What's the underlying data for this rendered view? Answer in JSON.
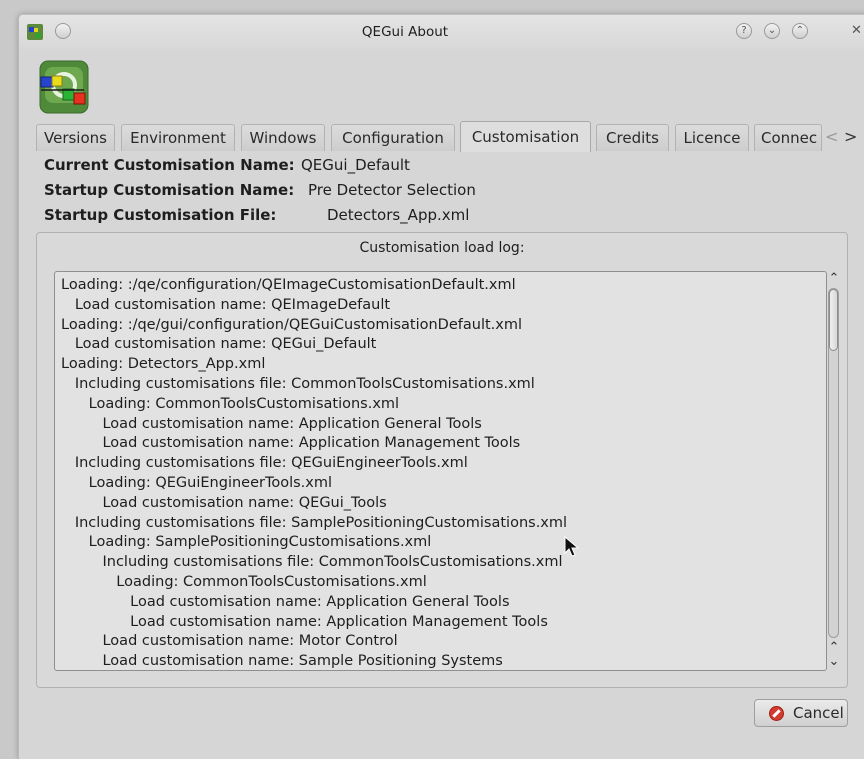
{
  "window": {
    "title": "QEGui About"
  },
  "titlebar_buttons": [
    {
      "name": "help",
      "glyph": "?"
    },
    {
      "name": "minimize",
      "glyph": "⌄"
    },
    {
      "name": "maximize",
      "glyph": "⌃"
    },
    {
      "name": "close",
      "glyph": "✕"
    }
  ],
  "tabs": [
    {
      "label": "Versions"
    },
    {
      "label": "Environment"
    },
    {
      "label": "Windows"
    },
    {
      "label": "Configuration"
    },
    {
      "label": "Customisation",
      "active": true
    },
    {
      "label": "Credits"
    },
    {
      "label": "Licence"
    },
    {
      "label": "Connec"
    }
  ],
  "tab_scroll": {
    "left": "<",
    "right": ">"
  },
  "info": {
    "current_name_label": "Current Customisation Name:",
    "current_name_value": "QEGui_Default",
    "startup_name_label": "Startup Customisation Name:",
    "startup_name_value": "Pre Detector Selection",
    "startup_file_label": "Startup Customisation File:",
    "startup_file_value": "Detectors_App.xml"
  },
  "log_group": {
    "title": "Customisation load log:",
    "lines": [
      "Loading: :/qe/configuration/QEImageCustomisationDefault.xml",
      "   Load customisation name: QEImageDefault",
      "Loading: :/qe/gui/configuration/QEGuiCustomisationDefault.xml",
      "   Load customisation name: QEGui_Default",
      "Loading: Detectors_App.xml",
      "   Including customisations file: CommonToolsCustomisations.xml",
      "      Loading: CommonToolsCustomisations.xml",
      "         Load customisation name: Application General Tools",
      "         Load customisation name: Application Management Tools",
      "   Including customisations file: QEGuiEngineerTools.xml",
      "      Loading: QEGuiEngineerTools.xml",
      "         Load customisation name: QEGui_Tools",
      "   Including customisations file: SamplePositioningCustomisations.xml",
      "      Loading: SamplePositioningCustomisations.xml",
      "         Including customisations file: CommonToolsCustomisations.xml",
      "            Loading: CommonToolsCustomisations.xml",
      "               Load customisation name: Application General Tools",
      "               Load customisation name: Application Management Tools",
      "         Load customisation name: Motor Control",
      "         Load customisation name: Sample Positioning Systems"
    ]
  },
  "scrollbar": {
    "position": 0
  },
  "footer": {
    "cancel_label": "Cancel"
  }
}
